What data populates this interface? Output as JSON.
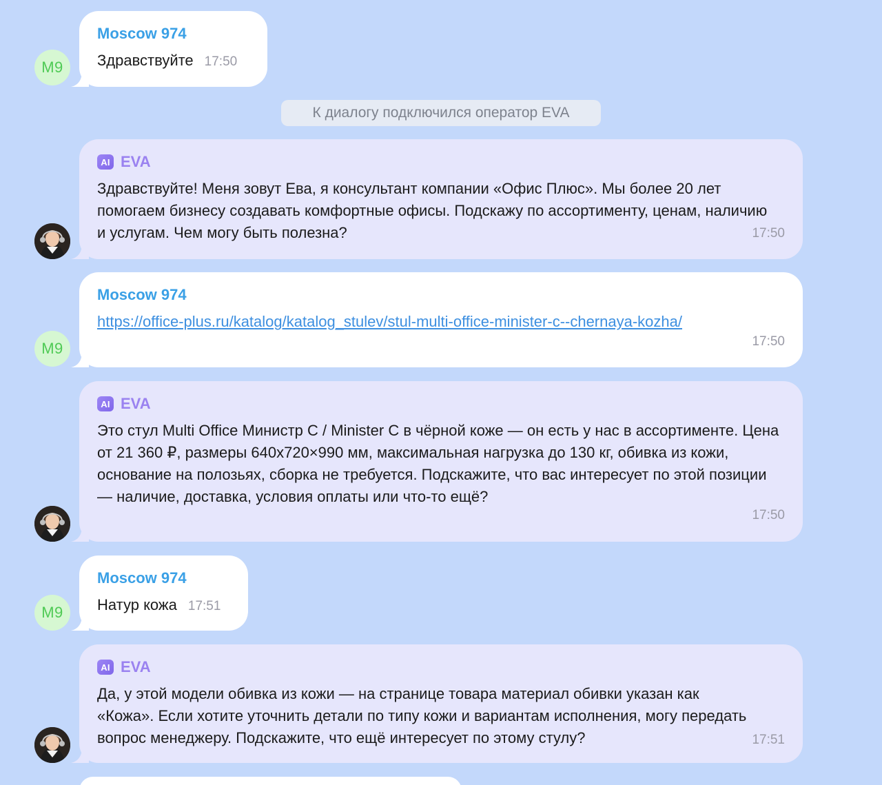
{
  "system_note": "К диалогу подключился оператор EVA",
  "user": {
    "name": "Moscow 974",
    "initials": "М9"
  },
  "bot": {
    "name": "EVA",
    "badge": "AI"
  },
  "messages": [
    {
      "text": "Здравствуйте",
      "time": "17:50"
    },
    {
      "text": "Здравствуйте! Меня зовут Ева, я консультант компании «Офис Плюс». Мы более 20 лет помогаем бизнесу создавать комфортные офисы. Подскажу по ассортименту, ценам, наличию и услугам. Чем могу быть полезна?",
      "time": "17:50"
    },
    {
      "text": "https://office-plus.ru/katalog/katalog_stulev/stul-multi-office-minister-c--chernaya-kozha/",
      "time": "17:50"
    },
    {
      "text": "Это стул Multi Office Министр С / Minister C в чёрной коже — он есть у нас в ассортименте. Цена от 21 360 ₽, размеры 640х720×990 мм, максимальная нагрузка до 130 кг, обивка из кожи, основание на полозьях, сборка не требуется. Подскажите, что вас интересует по этой позиции — наличие, доставка, условия оплаты или что-то ещё?",
      "time": "17:50"
    },
    {
      "text": "Натур кожа",
      "time": "17:51"
    },
    {
      "text": "Да, у этой модели обивка из кожи — на странице товара материал обивки указан как «Кожа». Если хотите уточнить детали по типу кожи и вариантам исполнения, могу передать вопрос менеджеру. Подскажите, что ещё интересует по этому стулу?",
      "time": "17:51"
    }
  ],
  "colors": {
    "background": "#c3d8fb",
    "user_bubble": "#ffffff",
    "bot_bubble": "#e6e6fc",
    "user_name": "#3aa0e6",
    "bot_name": "#9a82f0",
    "link": "#3d8fe0"
  },
  "icons": {
    "ai_badge": "ai-badge-icon",
    "bot_avatar": "operator-avatar-photo"
  }
}
